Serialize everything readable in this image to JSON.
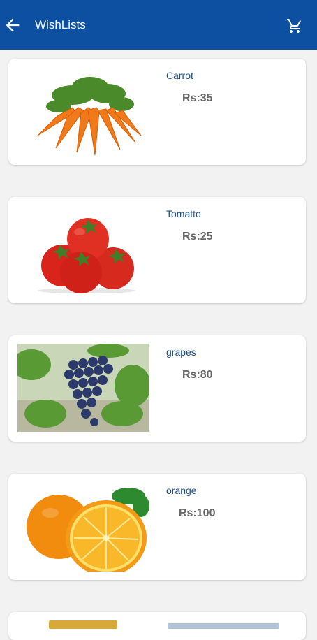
{
  "header": {
    "title": "WishLists",
    "back_icon": "arrow-left-icon",
    "cart_icon": "shopping-cart-icon",
    "bg_color": "#0d4fa0"
  },
  "items": [
    {
      "name": "Carrot",
      "price": "Rs:35",
      "image": "carrot-image"
    },
    {
      "name": "Tomatto",
      "price": "Rs:25",
      "image": "tomato-image"
    },
    {
      "name": "grapes",
      "price": "Rs:80",
      "image": "grapes-image"
    },
    {
      "name": "orange",
      "price": "Rs:100",
      "image": "orange-image"
    }
  ]
}
